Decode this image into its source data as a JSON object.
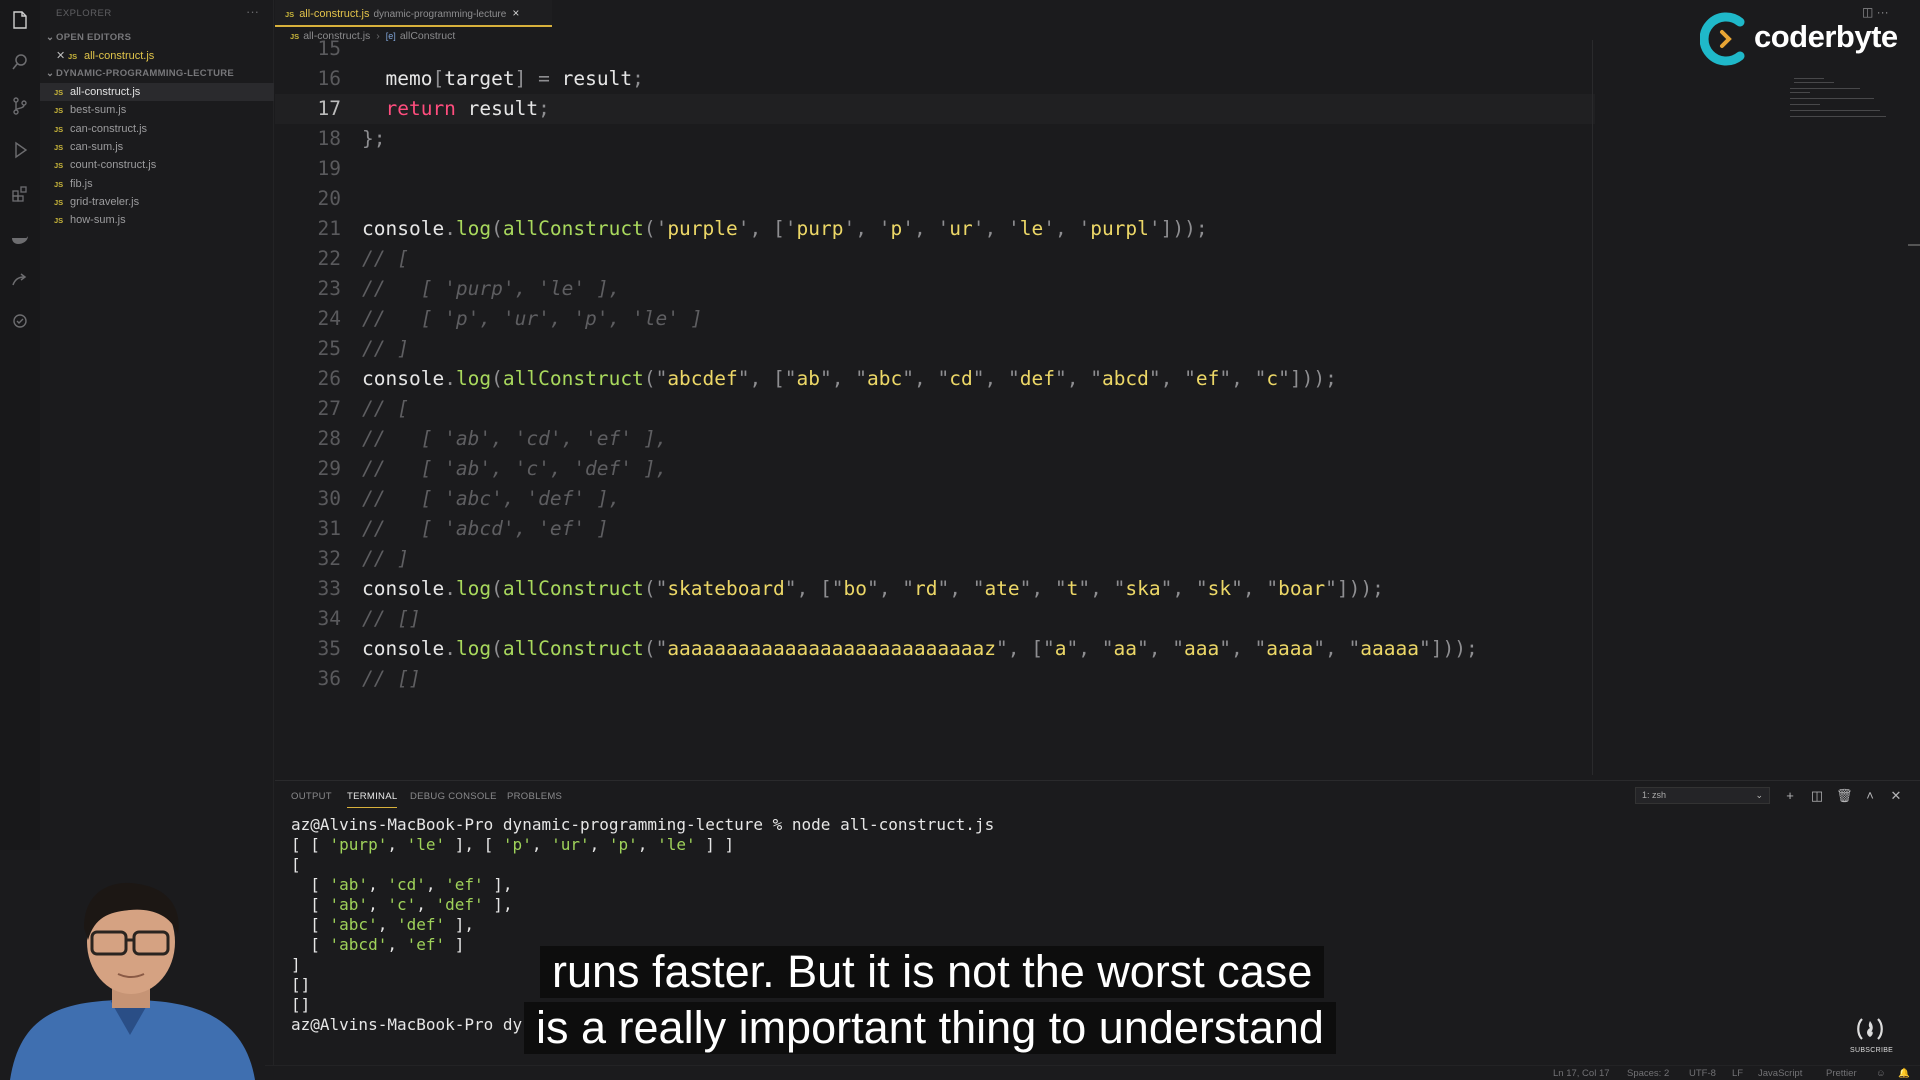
{
  "sidebar": {
    "header": "EXPLORER",
    "more": "···",
    "open_editors_label": "OPEN EDITORS",
    "open_file": {
      "icon": "JS",
      "name": "all-construct.js"
    },
    "folder_label": "DYNAMIC-PROGRAMMING-LECTURE",
    "files": [
      {
        "icon": "JS",
        "name": "all-construct.js"
      },
      {
        "icon": "JS",
        "name": "best-sum.js"
      },
      {
        "icon": "JS",
        "name": "can-construct.js"
      },
      {
        "icon": "JS",
        "name": "can-sum.js"
      },
      {
        "icon": "JS",
        "name": "count-construct.js"
      },
      {
        "icon": "JS",
        "name": "fib.js"
      },
      {
        "icon": "JS",
        "name": "grid-traveler.js"
      },
      {
        "icon": "JS",
        "name": "how-sum.js"
      }
    ]
  },
  "tab": {
    "icon": "JS",
    "name": "all-construct.js",
    "description": "dynamic-programming-lecture",
    "close": "×"
  },
  "breadcrumb": {
    "file": "all-construct.js",
    "symbol_icon": "[e]",
    "symbol": "allConstruct",
    "separator": "›"
  },
  "editor": {
    "lines": [
      {
        "n": "15",
        "code": ""
      },
      {
        "n": "16",
        "code": "  memo[target] = result;"
      },
      {
        "n": "17",
        "code": "  return result;"
      },
      {
        "n": "18",
        "code": "};"
      },
      {
        "n": "19",
        "code": ""
      },
      {
        "n": "20",
        "code": ""
      },
      {
        "n": "21",
        "code": "console.log(allConstruct('purple', ['purp', 'p', 'ur', 'le', 'purpl']));"
      },
      {
        "n": "22",
        "code": "// ["
      },
      {
        "n": "23",
        "code": "//   [ 'purp', 'le' ],"
      },
      {
        "n": "24",
        "code": "//   [ 'p', 'ur', 'p', 'le' ]"
      },
      {
        "n": "25",
        "code": "// ]"
      },
      {
        "n": "26",
        "code": "console.log(allConstruct(\"abcdef\", [\"ab\", \"abc\", \"cd\", \"def\", \"abcd\", \"ef\", \"c\"]));"
      },
      {
        "n": "27",
        "code": "// ["
      },
      {
        "n": "28",
        "code": "//   [ 'ab', 'cd', 'ef' ],"
      },
      {
        "n": "29",
        "code": "//   [ 'ab', 'c', 'def' ],"
      },
      {
        "n": "30",
        "code": "//   [ 'abc', 'def' ],"
      },
      {
        "n": "31",
        "code": "//   [ 'abcd', 'ef' ]"
      },
      {
        "n": "32",
        "code": "// ]"
      },
      {
        "n": "33",
        "code": "console.log(allConstruct(\"skateboard\", [\"bo\", \"rd\", \"ate\", \"t\", \"ska\", \"sk\", \"boar\"]));"
      },
      {
        "n": "34",
        "code": "// []"
      },
      {
        "n": "35",
        "code": "console.log(allConstruct(\"aaaaaaaaaaaaaaaaaaaaaaaaaaaz\", [\"a\", \"aa\", \"aaa\", \"aaaa\", \"aaaaa\"]));"
      },
      {
        "n": "36",
        "code": "// []"
      }
    ],
    "highlighted_line": "17"
  },
  "logo": {
    "text": "coderbyte",
    "brand_color": "#1fb8c9"
  },
  "panel": {
    "tabs": [
      "OUTPUT",
      "TERMINAL",
      "DEBUG CONSOLE",
      "PROBLEMS"
    ],
    "active_tab": "TERMINAL",
    "terminal_select": "1: zsh",
    "terminal_lines": [
      "az@Alvins-MacBook-Pro dynamic-programming-lecture % node all-construct.js",
      "[ [ 'purp', 'le' ], [ 'p', 'ur', 'p', 'le' ] ]",
      "[",
      "  [ 'ab', 'cd', 'ef' ],",
      "  [ 'ab', 'c', 'def' ],",
      "  [ 'abc', 'def' ],",
      "  [ 'abcd', 'ef' ]",
      "]",
      "[]",
      "[]",
      "az@Alvins-MacBook-Pro dy"
    ]
  },
  "status": {
    "position": "Ln 17, Col 17",
    "spaces": "Spaces: 2",
    "encoding": "UTF-8",
    "eol": "LF",
    "language": "JavaScript",
    "formatter": "Prettier"
  },
  "captions": {
    "line1": "runs faster. But it is not the worst case",
    "line2": "is a really important thing to understand"
  },
  "subscribe": {
    "label": "SUBSCRIBE"
  }
}
